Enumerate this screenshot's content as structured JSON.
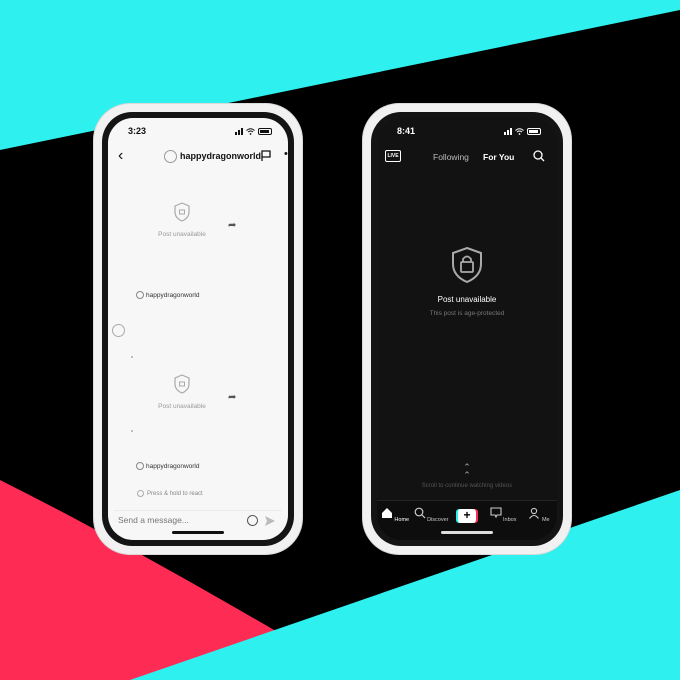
{
  "background": {
    "colors": {
      "cyan": "#2ef0ee",
      "black": "#000000",
      "red": "#fe2c55"
    }
  },
  "left_phone": {
    "status": {
      "time": "3:23"
    },
    "header": {
      "back_icon": "chevron-left-icon",
      "username": "happydragonworld",
      "flag_icon": "flag-icon",
      "more_icon": "more-icon"
    },
    "posts": [
      {
        "label": "Post unavailable",
        "sender": "happydragonworld"
      },
      {
        "label": "Post unavailable",
        "sender": "happydragonworld"
      }
    ],
    "react_hint": "Press & hold to react",
    "message_placeholder": "Send a message..."
  },
  "right_phone": {
    "status": {
      "time": "8:41"
    },
    "top_nav": {
      "live_label": "LIVE",
      "tab_following": "Following",
      "tab_for_you": "For You"
    },
    "unavailable": {
      "title": "Post unavailable",
      "subtitle": "This post is age-protected"
    },
    "scroll_hint": "Scroll to continue watching videos",
    "tabbar": [
      {
        "label": "Home",
        "icon": "home-icon"
      },
      {
        "label": "Discover",
        "icon": "search-icon"
      },
      {
        "label": "",
        "icon": "create-plus-icon"
      },
      {
        "label": "Inbox",
        "icon": "inbox-icon"
      },
      {
        "label": "Me",
        "icon": "profile-icon"
      }
    ]
  }
}
